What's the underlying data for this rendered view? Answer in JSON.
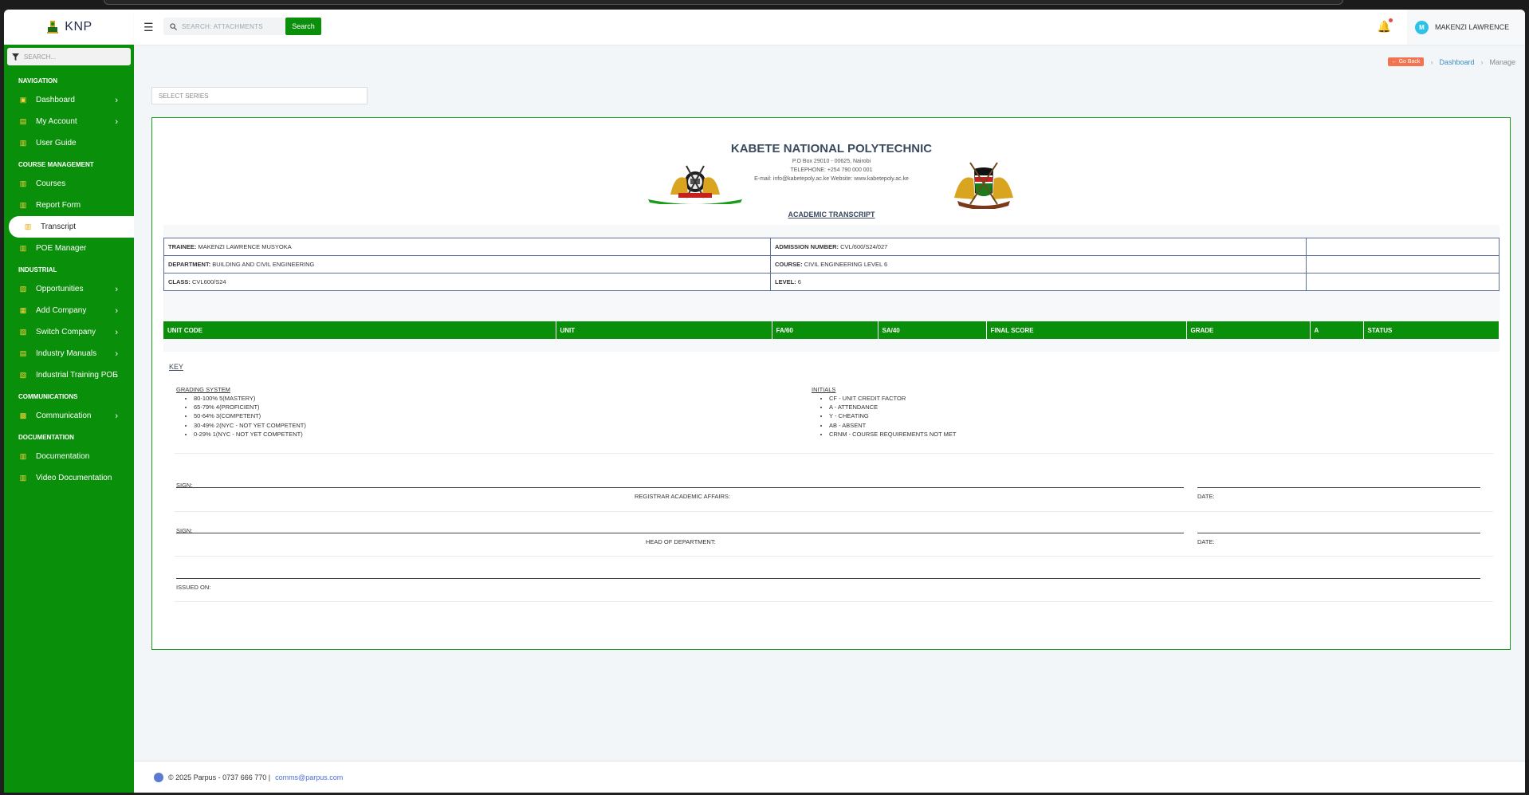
{
  "app": {
    "name": "KNP"
  },
  "sidebar": {
    "search_placeholder": "SEARCH...",
    "sections": [
      {
        "title": "NAVIGATION",
        "items": [
          {
            "label": "Dashboard",
            "icon": "monitor-icon",
            "chevron": true
          },
          {
            "label": "My Account",
            "icon": "id-card-icon",
            "chevron": true
          },
          {
            "label": "User Guide",
            "icon": "clipboard-icon",
            "chevron": false
          }
        ]
      },
      {
        "title": "COURSE MANAGEMENT",
        "items": [
          {
            "label": "Courses",
            "icon": "clipboard-icon",
            "chevron": false
          },
          {
            "label": "Report Form",
            "icon": "clipboard-icon",
            "chevron": false
          },
          {
            "label": "Transcript",
            "icon": "clipboard-icon",
            "chevron": false,
            "active": true
          },
          {
            "label": "POE Manager",
            "icon": "clipboard-icon",
            "chevron": false
          }
        ]
      },
      {
        "title": "INDUSTRIAL",
        "items": [
          {
            "label": "Opportunities",
            "icon": "edit-icon",
            "chevron": true
          },
          {
            "label": "Add Company",
            "icon": "building-icon",
            "chevron": true
          },
          {
            "label": "Switch Company",
            "icon": "switch-icon",
            "chevron": true
          },
          {
            "label": "Industry Manuals",
            "icon": "book-icon",
            "chevron": true
          },
          {
            "label": "Industrial Training POE",
            "icon": "edit-icon",
            "chevron": true
          }
        ]
      },
      {
        "title": "COMMUNICATIONS",
        "items": [
          {
            "label": "Communication",
            "icon": "message-icon",
            "chevron": true
          }
        ]
      },
      {
        "title": "DOCUMENTATION",
        "items": [
          {
            "label": "Documentation",
            "icon": "clipboard-icon",
            "chevron": false
          },
          {
            "label": "Video Documentation",
            "icon": "clipboard-icon",
            "chevron": false
          }
        ]
      }
    ]
  },
  "header": {
    "search_placeholder": "SEARCH: ATTACHMENTS",
    "search_button": "Search",
    "user_initial": "M",
    "user_name": "MAKENZI LAWRENCE"
  },
  "breadcrumb": {
    "go_back": "Go Back",
    "dashboard": "Dashboard",
    "current": "Manage"
  },
  "series_select": {
    "placeholder": "SELECT SERIES"
  },
  "transcript": {
    "institution": "KABETE NATIONAL POLYTECHNIC",
    "address": "P.O Box 29010 - 00625, Nairobi",
    "telephone": "TELEPHONE: +254 790 000 001",
    "contact": "E-mail: info@kabetepoly.ac.ke     Website: www.kabetepoly.ac.ke",
    "title": "ACADEMIC TRANSCRIPT",
    "info": {
      "trainee_label": "TRAINEE:",
      "trainee": "MAKENZI LAWRENCE MUSYOKA",
      "admission_label": "ADMISSION NUMBER:",
      "admission": "CVL/600/S24/027",
      "department_label": "DEPARTMENT:",
      "department": "BUILDING AND CIVIL ENGINEERING",
      "course_label": "COURSE:",
      "course": "CIVIL ENGINEERING LEVEL 6",
      "class_label": "CLASS:",
      "class": "CVL600/S24",
      "level_label": "LEVEL:",
      "level": "6"
    },
    "columns": [
      "UNIT CODE",
      "UNIT",
      "FA/60",
      "SA/40",
      "FINAL SCORE",
      "GRADE",
      "A",
      "STATUS"
    ],
    "key": {
      "title": "KEY",
      "grading_title": "GRADING SYSTEM",
      "grading": [
        "80-100% 5(MASTERY)",
        "65-79% 4(PROFICIENT)",
        "50-64% 3(COMPETENT)",
        "30-49% 2(NYC - NOT YET COMPETENT)",
        "0-29% 1(NYC - NOT YET COMPETENT)"
      ],
      "initials_title": "INITIALS",
      "initials": [
        "CF - UNIT CREDIT FACTOR",
        "A - ATTENDANCE",
        "Y - CHEATING",
        "AB - ABSENT",
        "CRNM - COURSE REQUIREMENTS NOT MET"
      ]
    },
    "signatures": {
      "sign": "SIGN:",
      "registrar": "REGISTRAR ACADEMIC AFFAIRS:",
      "hod": "HEAD OF DEPARTMENT:",
      "date": "DATE:",
      "issued_on": "ISSUED ON:"
    }
  },
  "footer": {
    "copyright": "© 2025 Parpus - 0737 666 770 |",
    "email": "comms@parpus.com"
  },
  "colors": {
    "brand_green": "#0a8f0a",
    "accent_yellow": "#ffd23f"
  }
}
